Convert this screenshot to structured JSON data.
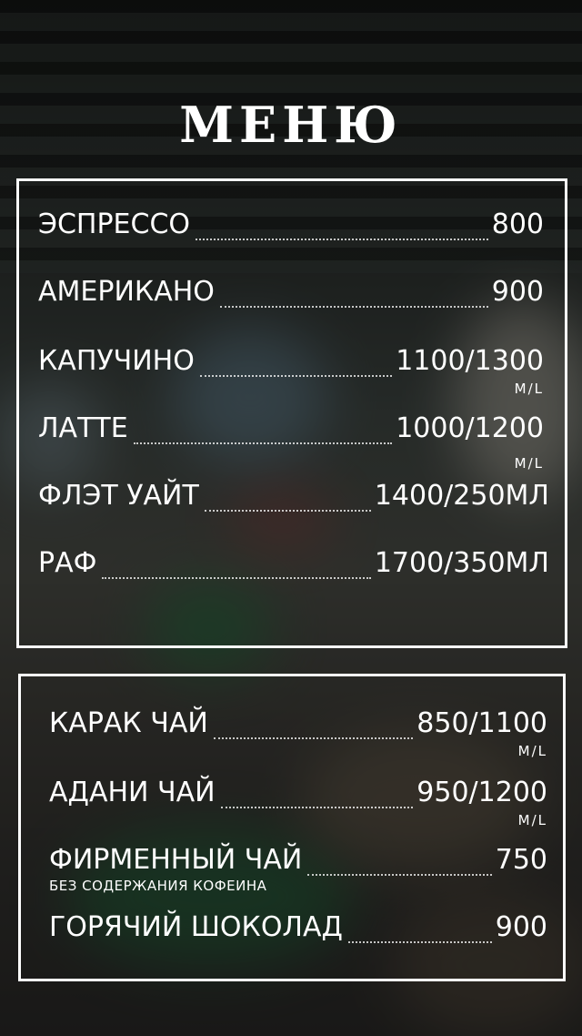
{
  "title": "МЕНЮ",
  "coffee": [
    {
      "name": "ЭСПРЕССО",
      "price": "800",
      "size": ""
    },
    {
      "name": "АМЕРИКАНО",
      "price": "900",
      "size": ""
    },
    {
      "name": "КАПУЧИНО",
      "price": "1100/1300",
      "size": "M/L"
    },
    {
      "name": "ЛАТТЕ",
      "price": "1000/1200",
      "size": "M/L"
    },
    {
      "name": "ФЛЭТ УАЙТ",
      "price": "1400/250МЛ",
      "size": ""
    },
    {
      "name": "РАФ",
      "price": "1700/350МЛ",
      "size": ""
    }
  ],
  "other": [
    {
      "name": "КАРАК ЧАЙ",
      "price": "850/1100",
      "size": "M/L",
      "note": ""
    },
    {
      "name": "АДАНИ ЧАЙ",
      "price": "950/1200",
      "size": "M/L",
      "note": ""
    },
    {
      "name": "ФИРМЕННЫЙ ЧАЙ",
      "price": "750",
      "size": "",
      "note": "БЕЗ СОДЕРЖАНИЯ КОФЕИНА"
    },
    {
      "name": "ГОРЯЧИЙ ШОКОЛАД",
      "price": "900",
      "size": "",
      "note": ""
    }
  ]
}
